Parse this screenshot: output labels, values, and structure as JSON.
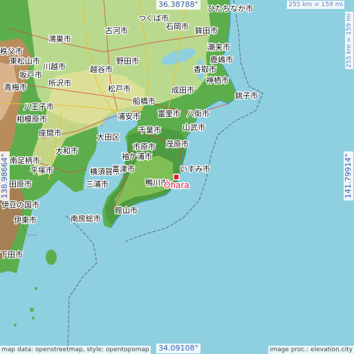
{
  "coords": {
    "north": "36.38788°",
    "south": "34.09108°",
    "west": "138.98664°",
    "east": "141.79914°"
  },
  "scale": {
    "top": "255 km = 159 mi",
    "right": "255 km = 159 mi"
  },
  "highlight": {
    "label": "Ōhara",
    "marker": "pin-marker"
  },
  "attribution": {
    "left": "map data: openstreetmap, style: opentopomap",
    "right": "image proc.: elevation.city"
  },
  "cities": [
    {
      "name": "ひたちなか市"
    },
    {
      "name": "石岡市"
    },
    {
      "name": "鉾田市"
    },
    {
      "name": "鹿嶋市"
    },
    {
      "name": "神栖市"
    },
    {
      "name": "銚子市"
    },
    {
      "name": "成田市"
    },
    {
      "name": "八街市"
    },
    {
      "name": "山武市"
    },
    {
      "name": "千葉市"
    },
    {
      "name": "茂原市"
    },
    {
      "name": "市原市"
    },
    {
      "name": "いすみ市"
    },
    {
      "name": "鴨川市"
    },
    {
      "name": "館山市"
    },
    {
      "name": "南房総市"
    },
    {
      "name": "横須賀市"
    },
    {
      "name": "三浦市"
    },
    {
      "name": "大田区"
    },
    {
      "name": "富里市"
    },
    {
      "name": "船橋市"
    },
    {
      "name": "松戸市"
    },
    {
      "name": "野田市"
    },
    {
      "name": "古河市"
    },
    {
      "name": "越谷市"
    },
    {
      "name": "川越市"
    },
    {
      "name": "所沢市"
    },
    {
      "name": "八王子市"
    },
    {
      "name": "相模原市"
    },
    {
      "name": "座間市"
    },
    {
      "name": "大和市"
    },
    {
      "name": "平塚市"
    },
    {
      "name": "南足柄市"
    },
    {
      "name": "伊豆の国市"
    },
    {
      "name": "伊東市"
    },
    {
      "name": "下田市"
    },
    {
      "name": "小田原市"
    },
    {
      "name": "青梅市"
    },
    {
      "name": "東松山市"
    },
    {
      "name": "秩父市"
    },
    {
      "name": "鴻巣市"
    },
    {
      "name": "坂戸市"
    },
    {
      "name": "浦安市"
    },
    {
      "name": "富津市"
    },
    {
      "name": "袖ケ浦市"
    },
    {
      "name": "香取市"
    },
    {
      "name": "潮来市"
    },
    {
      "name": "つくば市"
    }
  ]
}
